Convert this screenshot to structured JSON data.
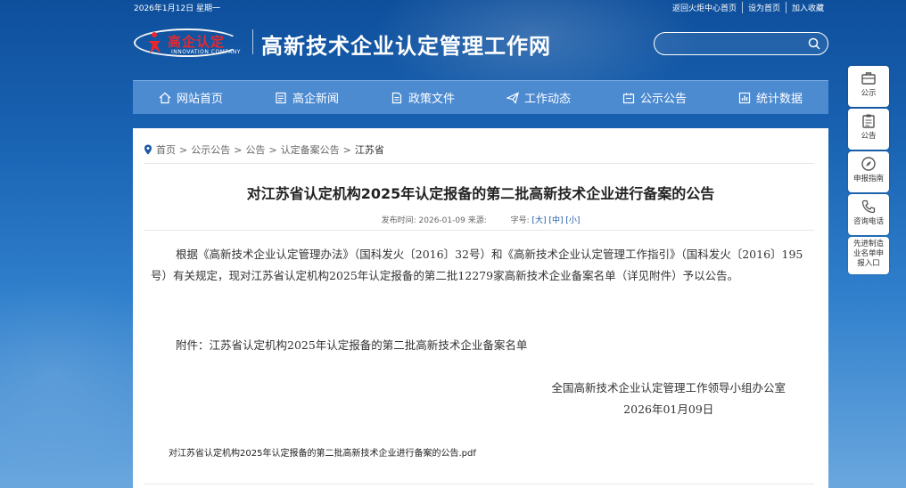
{
  "topbar": {
    "date": "2026年1月12日 星期一",
    "links": [
      "返回火炬中心首页",
      "设为首页",
      "加入收藏"
    ]
  },
  "header": {
    "logo_mark": "高",
    "logo_name": "高企认定",
    "logo_en": "INNOVATION COMPANY",
    "site_title": "高新技术企业认定管理工作网",
    "search_placeholder": ""
  },
  "nav": {
    "items": [
      {
        "label": "网站首页",
        "icon": "home-icon"
      },
      {
        "label": "高企新闻",
        "icon": "news-icon"
      },
      {
        "label": "政策文件",
        "icon": "document-icon"
      },
      {
        "label": "工作动态",
        "icon": "send-icon"
      },
      {
        "label": "公示公告",
        "icon": "notice-icon"
      },
      {
        "label": "统计数据",
        "icon": "chart-icon"
      }
    ]
  },
  "breadcrumb": {
    "items": [
      "首页",
      "公示公告",
      "公告",
      "认定备案公告"
    ],
    "current": "江苏省"
  },
  "article": {
    "title": "对江苏省认定机构2025年认定报备的第二批高新技术企业进行备案的公告",
    "publish_label": "发布时间:",
    "publish_date": "2026-01-09",
    "source_label": "来源:",
    "font_size_label": "字号:",
    "size_large": "[大]",
    "size_medium": "[中]",
    "size_small": "[小]",
    "paragraph": "根据《高新技术企业认定管理办法》（国科发火〔2016〕32号）和《高新技术企业认定管理工作指引》（国科发火〔2016〕195号）有关规定，现对江苏省认定机构2025年认定报备的第二批12279家高新技术企业备案名单（详见附件）予以公告。",
    "attachment": "附件：江苏省认定机构2025年认定报备的第二批高新技术企业备案名单",
    "signer": "全国高新技术企业认定管理工作领导小组办公室",
    "sign_date": "2026年01月09日",
    "file_link": "对江苏省认定机构2025年认定报备的第二批高新技术企业进行备案的公告.pdf"
  },
  "side_widgets": [
    {
      "label": "公示",
      "icon": "briefcase-icon"
    },
    {
      "label": "公告",
      "icon": "clipboard-icon"
    },
    {
      "label": "申报指南",
      "icon": "compass-icon"
    },
    {
      "label": "咨询电话",
      "icon": "phone-icon"
    },
    {
      "label": "先进制造业名单申报入口",
      "icon": ""
    }
  ],
  "colors": {
    "nav_bg": "#4d8bd1",
    "logo_red": "#e8282c",
    "link_blue": "#1a56a8"
  }
}
